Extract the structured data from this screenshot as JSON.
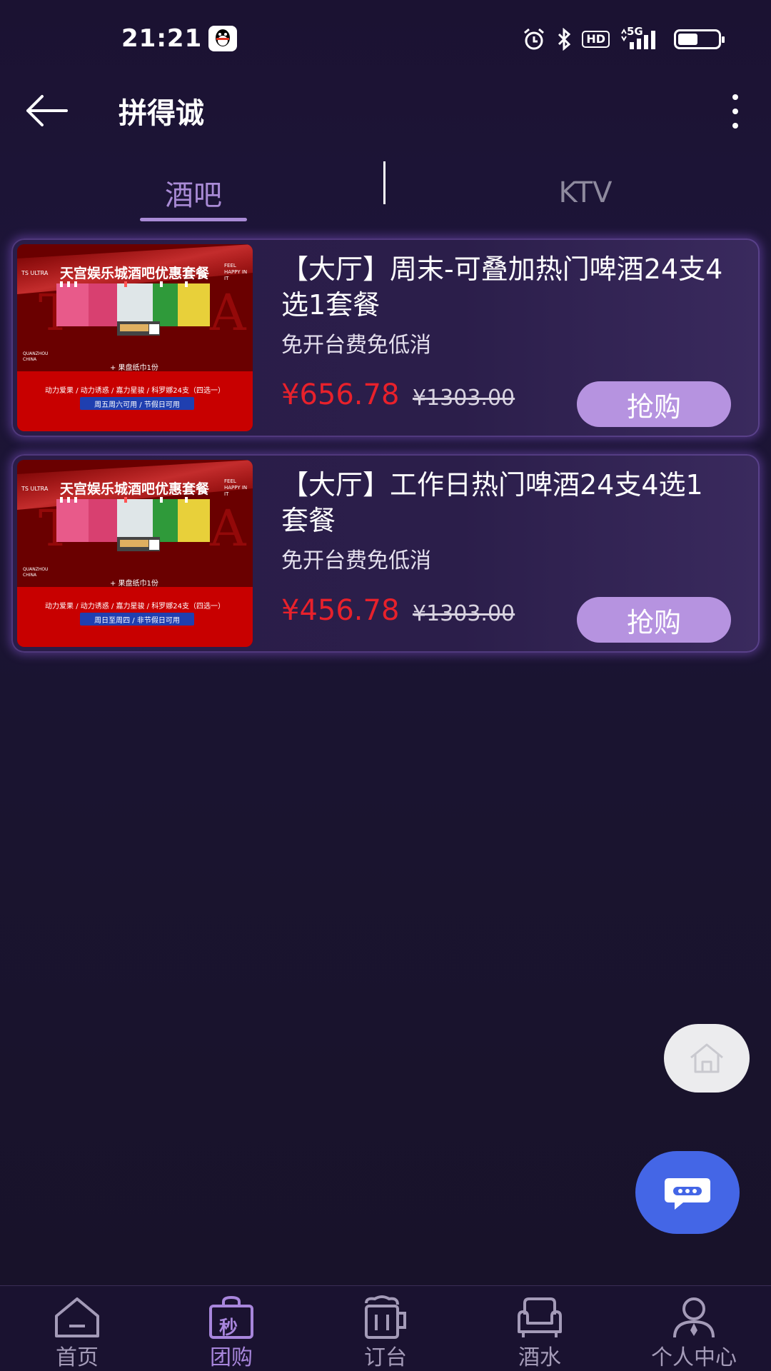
{
  "status_bar": {
    "time": "21:21",
    "network": "5G",
    "hd": "HD",
    "battery_level": 0.55,
    "icons": [
      "qq-icon",
      "alarm-icon",
      "bluetooth-icon",
      "hd-icon",
      "signal-icon",
      "battery-icon"
    ]
  },
  "app_bar": {
    "title": "拼得诚",
    "icons": [
      "back-arrow-icon",
      "more-vertical-icon"
    ]
  },
  "tabs": [
    {
      "label": "酒吧",
      "active": true
    },
    {
      "label": "KTV",
      "active": false
    }
  ],
  "products": [
    {
      "title": "【大厅】周末-可叠加热门啤酒24支4选1套餐",
      "subtitle": "免开台费免低消",
      "price": "¥656.78",
      "original_price": "¥1303.00",
      "buy_label": "抢购",
      "image": {
        "brand": "TS ULTRA",
        "headline": "天宫娱乐城酒吧优惠套餐",
        "side_text": "FEEL HAPPY IN IT",
        "location": "QUANZHOU CHINA",
        "snack": "+ 果盘纸巾1份",
        "choices": "动力爱果 / 动力诱惑 / 嘉力星骏 / 科罗娜24支（四选一）",
        "days": "周五周六可用 / 节假日可用"
      }
    },
    {
      "title": "【大厅】工作日热门啤酒24支4选1套餐",
      "subtitle": "免开台费免低消",
      "price": "¥456.78",
      "original_price": "¥1303.00",
      "buy_label": "抢购",
      "image": {
        "brand": "TS ULTRA",
        "headline": "天宫娱乐城酒吧优惠套餐",
        "side_text": "FEEL HAPPY IN IT",
        "location": "QUANZHOU CHINA",
        "snack": "+ 果盘纸巾1份",
        "choices": "动力爱果 / 动力诱惑 / 嘉力星骏 / 科罗娜24支（四选一）",
        "days": "周日至周四 / 非节假日可用"
      }
    }
  ],
  "floating": {
    "home_icon": "home-icon",
    "chat_icon": "chat-bubble-icon",
    "home_bg": "#ececee",
    "chat_bg": "#4466e6"
  },
  "bottom_nav": [
    {
      "label": "首页",
      "icon": "home-nav-icon",
      "active": false
    },
    {
      "label": "团购",
      "icon": "flash-sale-bag-icon",
      "icon_text": "秒",
      "active": true
    },
    {
      "label": "订台",
      "icon": "beer-mug-icon",
      "active": false
    },
    {
      "label": "酒水",
      "icon": "sofa-icon",
      "active": false
    },
    {
      "label": "个人中心",
      "icon": "user-icon",
      "active": false
    }
  ],
  "colors": {
    "accent": "#a98bd6",
    "price": "#e8212b",
    "buy_button": "#b693e0",
    "background": "#1b1232"
  }
}
